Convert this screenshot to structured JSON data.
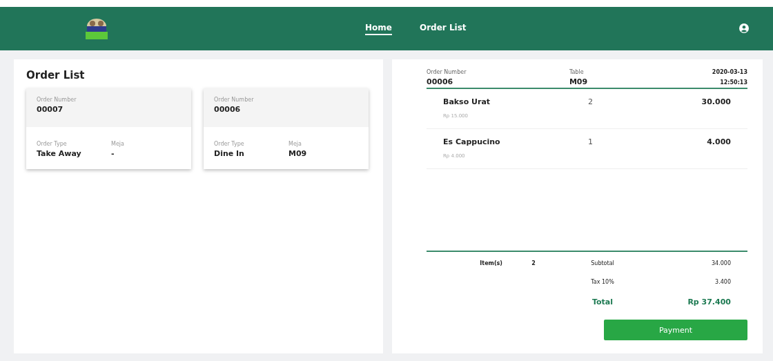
{
  "nav": {
    "links": [
      {
        "label": "Home",
        "selected": true
      },
      {
        "label": "Order List",
        "selected": false
      }
    ]
  },
  "order_list": {
    "title": "Order List",
    "orders": [
      {
        "number_label": "Order Number",
        "number": "00007",
        "type_label": "Order Type",
        "type": "Take Away",
        "table_label": "Meja",
        "table": "-"
      },
      {
        "number_label": "Order Number",
        "number": "00006",
        "type_label": "Order Type",
        "type": "Dine In",
        "table_label": "Meja",
        "table": "M09"
      }
    ]
  },
  "order_detail": {
    "number_label": "Order Number",
    "number": "00006",
    "table_label": "Table",
    "table": "M09",
    "date": "2020-03-13",
    "time": "12:50:13",
    "items": [
      {
        "name": "Bakso Urat",
        "price": "Rp 15.000",
        "qty": "2",
        "amount": "30.000"
      },
      {
        "name": "Es Cappucino",
        "price": "Rp 4.000",
        "qty": "1",
        "amount": "4.000"
      }
    ],
    "items_label": "Item(s)",
    "items_count": "2",
    "subtotal_label": "Subtotal",
    "subtotal": "34.000",
    "tax_label": "Tax 10%",
    "tax": "3.400",
    "total_label": "Total",
    "total": "Rp 37.400",
    "button": "Payment"
  }
}
